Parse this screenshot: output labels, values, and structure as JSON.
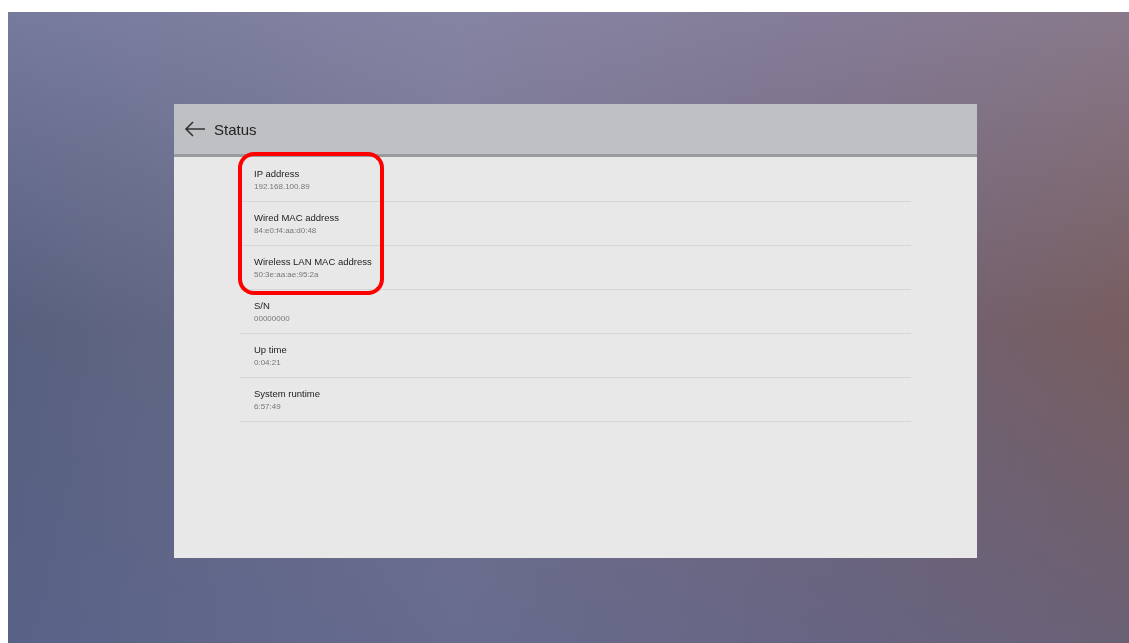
{
  "header": {
    "title": "Status"
  },
  "items": [
    {
      "label": "IP address",
      "value": "192.168.100.89",
      "highlighted": true
    },
    {
      "label": "Wired MAC address",
      "value": "84:e0:f4:aa:d0:48",
      "highlighted": true
    },
    {
      "label": "Wireless LAN MAC address",
      "value": "50:3e:aa:ae:95:2a",
      "highlighted": true
    },
    {
      "label": "S/N",
      "value": "00000000",
      "highlighted": false
    },
    {
      "label": "Up time",
      "value": "0:04:21",
      "highlighted": false
    },
    {
      "label": "System runtime",
      "value": "6:57:49",
      "highlighted": false
    }
  ]
}
